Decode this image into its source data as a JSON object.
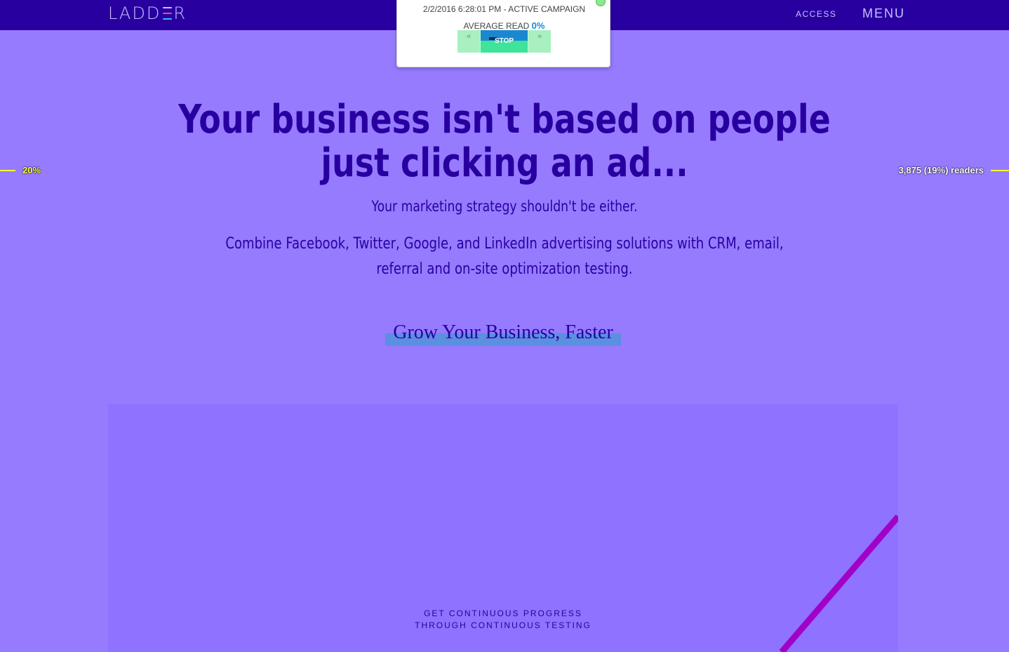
{
  "nav": {
    "logo_left": "LADD",
    "logo_right": "R",
    "access_label": "ACCESS",
    "menu_label": "MENU"
  },
  "popup": {
    "title": "2/2/2016 6:28:01 PM - ACTIVE CAMPAIGN",
    "average_read_label": "AVERAGE READ",
    "average_read_value": "0%",
    "prev_glyph": "«",
    "stop_label": "STOP",
    "next_glyph": "»"
  },
  "hero": {
    "title_line1": "Your business isn't based on people",
    "title_line2": "just clicking an ad...",
    "subtitle": "Your marketing strategy shouldn't be either.",
    "description": "Combine Facebook, Twitter, Google, and LinkedIn advertising solutions with CRM, email, referral and on-site optimization testing.",
    "cta": "Grow Your Business, Faster"
  },
  "markers": {
    "left_percent": "20%",
    "right_readers": "3,875 (19%) readers"
  },
  "panel": {
    "caption_line1": "GET CONTINUOUS PROGRESS",
    "caption_line2": "THROUGH CONTINUOUS TESTING"
  },
  "colors": {
    "background": "#967bff",
    "nav": "#2800a0",
    "text_primary": "#2800a0",
    "marker": "#ffff33",
    "accent_line": "#a000c8"
  }
}
